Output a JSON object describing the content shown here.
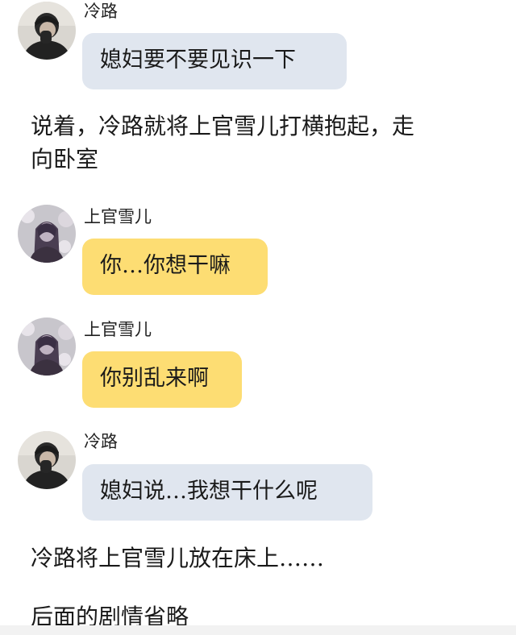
{
  "messages": [
    {
      "speaker": "冷路",
      "text": "媳妇要不要见识一下",
      "bubble_color": "#e0e6ef",
      "avatar": "boy-avatar-icon"
    },
    {
      "speaker": "上官雪儿",
      "text": "你…你想干嘛",
      "bubble_color": "#fddd73",
      "avatar": "girl-avatar-icon"
    },
    {
      "speaker": "上官雪儿",
      "text": "你别乱来啊",
      "bubble_color": "#fddd73",
      "avatar": "girl-avatar-icon"
    },
    {
      "speaker": "冷路",
      "text": "媳妇说…我想干什么呢",
      "bubble_color": "#e0e6ef",
      "avatar": "boy-avatar-icon"
    }
  ],
  "narration": {
    "line1": "说着，冷路就将上官雪儿打横抱起，走",
    "line1_cont": "向卧室",
    "line2": "冷路将上官雪儿放在床上……",
    "line3": "后面的剧情省略"
  }
}
